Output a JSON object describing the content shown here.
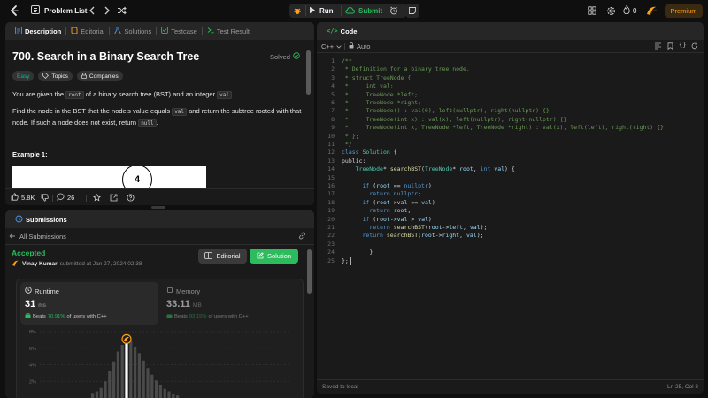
{
  "topbar": {
    "problem_list": "Problem List",
    "run": "Run",
    "submit": "Submit",
    "coins": "0",
    "premium": "Premium"
  },
  "left_tabs": [
    {
      "label": "Description"
    },
    {
      "label": "Editorial"
    },
    {
      "label": "Solutions"
    },
    {
      "label": "Testcase"
    },
    {
      "label": "Test Result"
    }
  ],
  "problem": {
    "title": "700. Search in a Binary Search Tree",
    "status": "Solved",
    "difficulty": "Easy",
    "topics": "Topics",
    "companies": "Companies",
    "p1a": "You are given the",
    "p1code1": "root",
    "p1b": "of a binary search tree (BST) and an integer",
    "p1code2": "val",
    "p1c": ".",
    "p2a": "Find the node in the BST that the node's value equals",
    "p2code1": "val",
    "p2b": "and return the subtree rooted with that",
    "p2c": "node. If such a node does not exist, return",
    "p2code2": "null",
    "p2d": ".",
    "example_title": "Example 1:",
    "tree_root_value": "4",
    "likes": "5.8K",
    "comments": "26"
  },
  "submissions": {
    "title": "Submissions",
    "all_label": "All Submissions",
    "status": "Accepted",
    "user": "Vinay Kumar",
    "submitted_text": "submitted at Jan 27, 2024 02:38",
    "editorial_btn": "Editorial",
    "solution_btn": "Solution",
    "runtime_label": "Runtime",
    "runtime_value": "31",
    "runtime_unit": "ms",
    "runtime_beats_pre": "Beats",
    "runtime_beats_pct": "70.91%",
    "runtime_beats_post": "of users with C++",
    "memory_label": "Memory",
    "memory_value": "33.11",
    "memory_unit": "MB",
    "memory_beats_pre": "Beats",
    "memory_beats_pct": "93.15%",
    "memory_beats_post": "of users with C++",
    "chart_ticks": [
      "8%",
      "6%",
      "4%",
      "2%"
    ]
  },
  "chart_data": {
    "type": "bar",
    "ylim": [
      0,
      8
    ],
    "yticks": [
      "8%",
      "6%",
      "4%",
      "2%"
    ],
    "values": [
      0.6,
      0.8,
      1.2,
      2.0,
      3.2,
      4.4,
      5.6,
      6.4,
      7.0,
      6.9,
      6.2,
      5.4,
      4.5,
      3.6,
      2.8,
      2.1,
      1.6,
      1.1,
      0.8,
      0.5,
      0.3
    ],
    "highlight_index": 8,
    "highlight_color": "#ffa116"
  },
  "editor": {
    "title": "Code",
    "language": "C++",
    "auto": "Auto",
    "saved": "Saved to local",
    "cursor": "Ln 25, Col 3"
  },
  "code_lines": [
    "/**",
    " * Definition for a binary tree node.",
    " * struct TreeNode {",
    " *     int val;",
    " *     TreeNode *left;",
    " *     TreeNode *right;",
    " *     TreeNode() : val(0), left(nullptr), right(nullptr) {}",
    " *     TreeNode(int x) : val(x), left(nullptr), right(nullptr) {}",
    " *     TreeNode(int x, TreeNode *left, TreeNode *right) : val(x), left(left), right(right) {}",
    " * };",
    " */",
    "class Solution {",
    "public:",
    "    TreeNode* searchBST(TreeNode* root, int val) {",
    "",
    "      if (root == nullptr)",
    "        return nullptr;",
    "      if (root->val == val)",
    "        return root;",
    "      if (root->val > val)",
    "        return searchBST(root->left, val);",
    "      return searchBST(root->right, val);",
    "",
    "        }",
    "};"
  ],
  "colors": {
    "accent": "#ffa116",
    "green": "#2cbb5d",
    "easy": "#00b8a3"
  }
}
